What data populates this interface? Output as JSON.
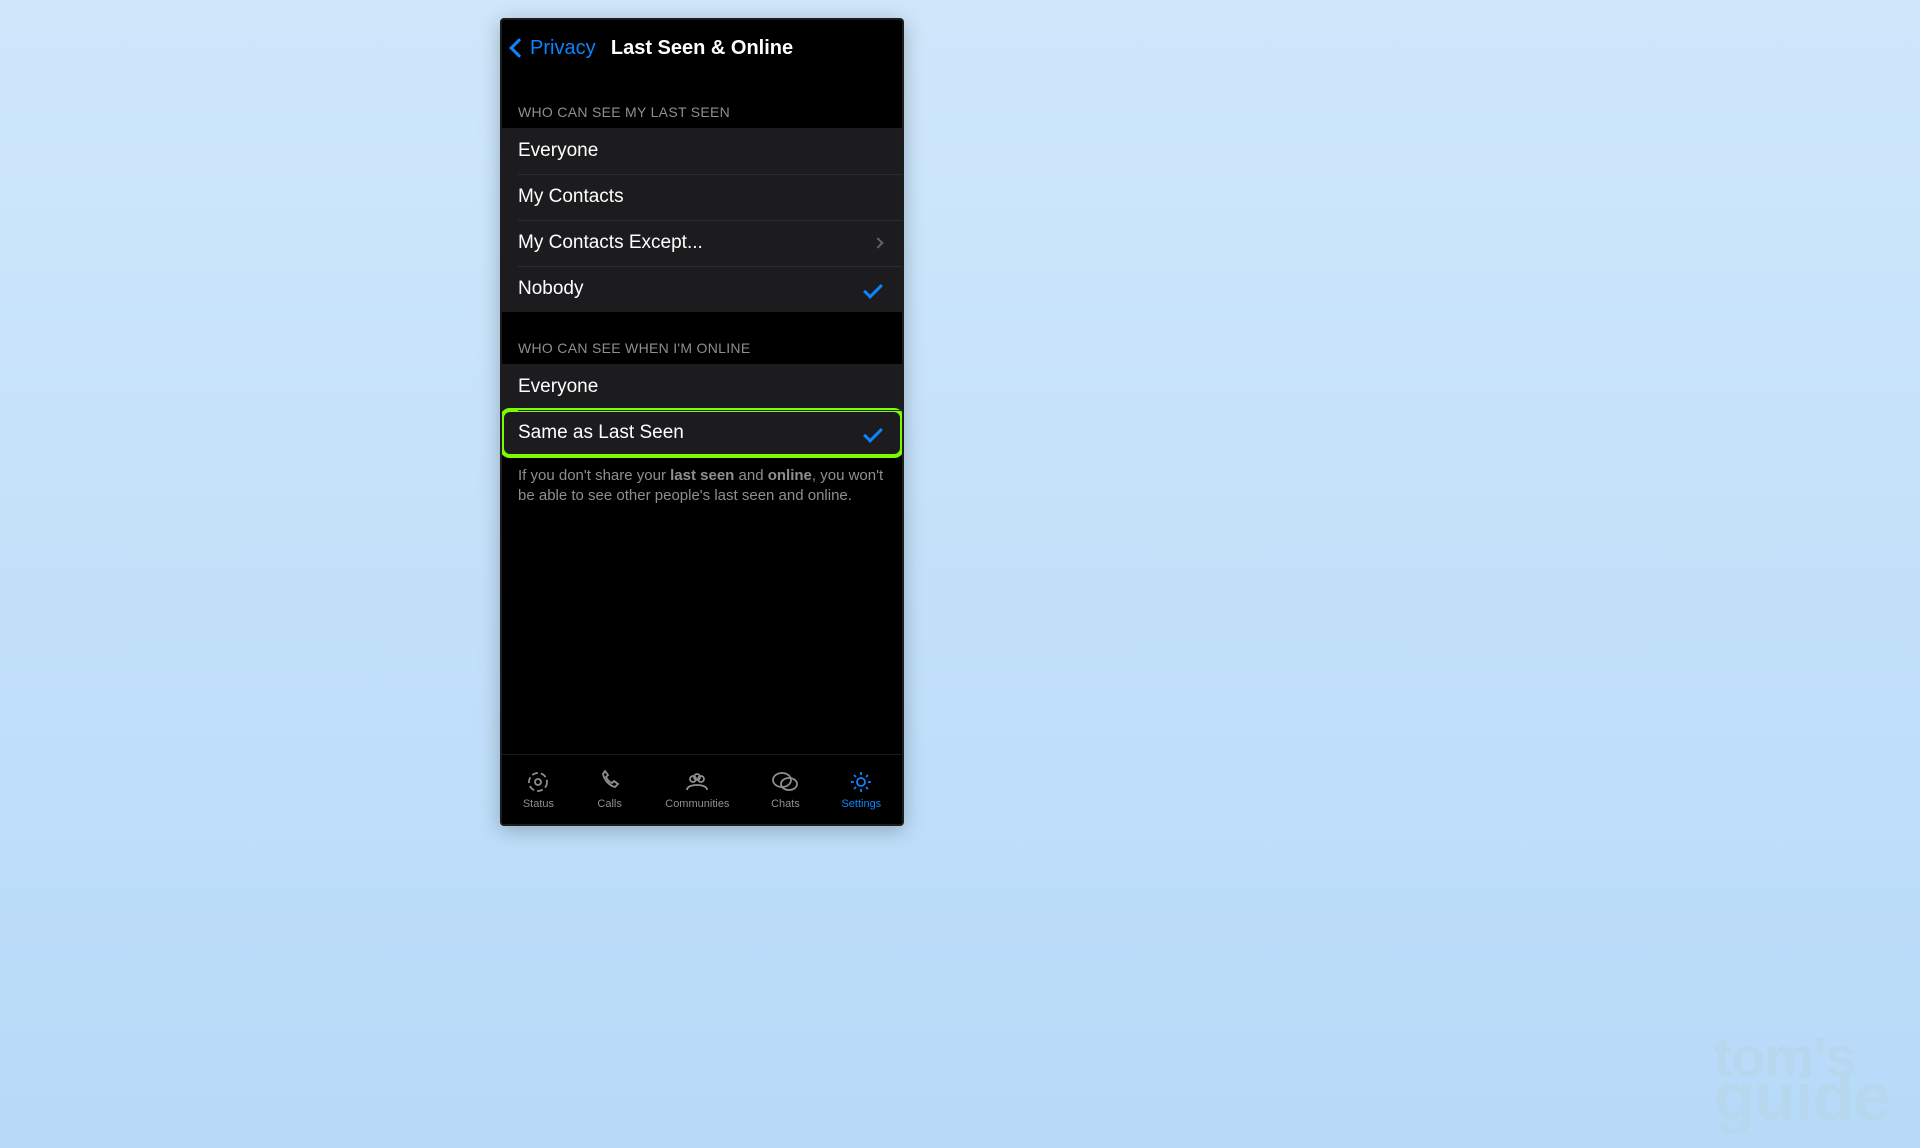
{
  "nav": {
    "back": "Privacy",
    "title": "Last Seen & Online"
  },
  "section1": {
    "header": "WHO CAN SEE MY LAST SEEN",
    "opt1": "Everyone",
    "opt2": "My Contacts",
    "opt3": "My Contacts Except...",
    "opt4": "Nobody"
  },
  "section2": {
    "header": "WHO CAN SEE WHEN I'M ONLINE",
    "opt1": "Everyone",
    "opt2": "Same as Last Seen"
  },
  "note": {
    "p1": "If you don't share your ",
    "b1": "last seen",
    "p2": " and ",
    "b2": "online",
    "p3": ", you won't be able to see other people's last seen and online."
  },
  "tabs": {
    "status": "Status",
    "calls": "Calls",
    "communities": "Communities",
    "chats": "Chats",
    "settings": "Settings"
  },
  "watermark": {
    "l1": "tom's",
    "l2": "guide"
  }
}
